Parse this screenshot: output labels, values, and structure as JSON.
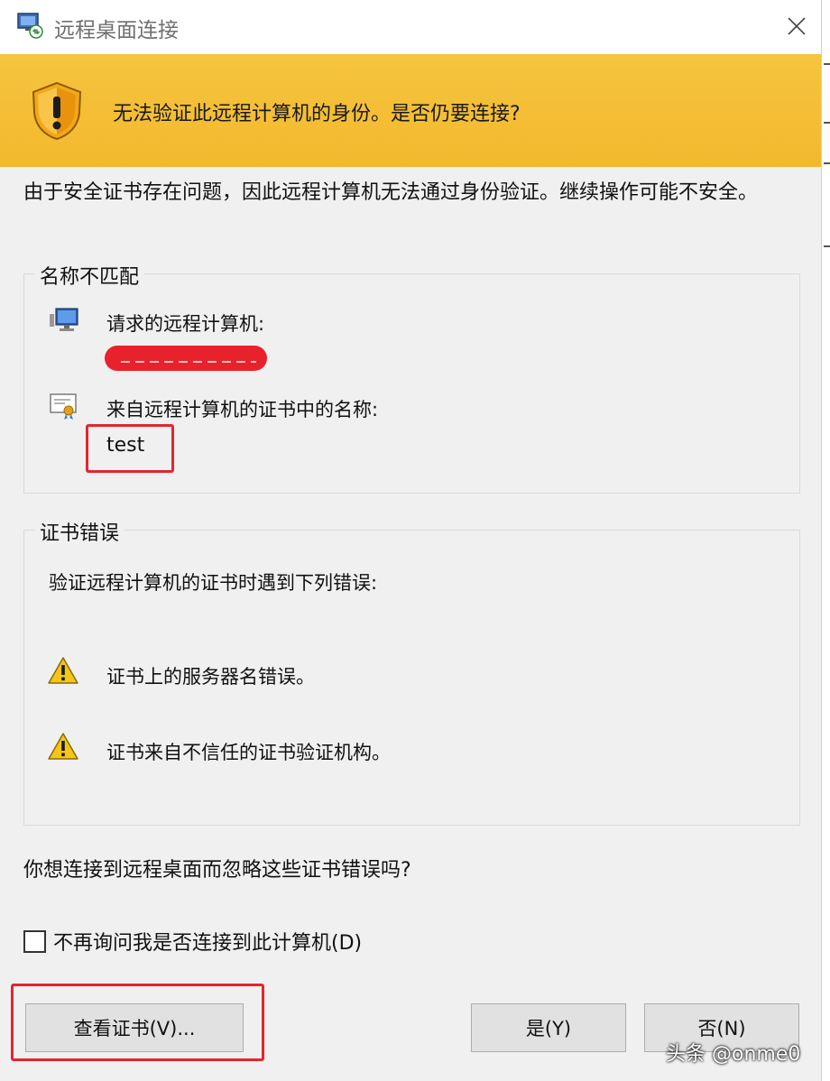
{
  "window": {
    "title": "远程桌面连接",
    "icon": "remote-desktop-icon",
    "close_icon": "close-icon"
  },
  "banner": {
    "icon": "shield-warning-icon",
    "text": "无法验证此远程计算机的身份。是否仍要连接?",
    "color": "#f4be35"
  },
  "description": "由于安全证书存在问题，因此远程计算机无法通过身份验证。继续操作可能不安全。",
  "name_mismatch": {
    "title": "名称不匹配",
    "requested_label": "请求的远程计算机:",
    "requested_icon": "computer-icon",
    "cert_name_label": "来自远程计算机的证书中的名称:",
    "cert_icon": "certificate-icon",
    "cert_name_value": "test"
  },
  "cert_errors": {
    "title": "证书错误",
    "intro": "验证远程计算机的证书时遇到下列错误:",
    "items": [
      {
        "icon": "warning-icon",
        "text": "证书上的服务器名错误。"
      },
      {
        "icon": "warning-icon",
        "text": "证书来自不信任的证书验证机构。"
      }
    ]
  },
  "question": "你想连接到远程桌面而忽略这些证书错误吗?",
  "dont_ask": {
    "label": "不再询问我是否连接到此计算机(D)",
    "checked": false
  },
  "buttons": {
    "view_cert": "查看证书(V)...",
    "yes": "是(Y)",
    "no": "否(N)"
  },
  "annotation_color": "#e3262f",
  "watermark": "头条 @onme0"
}
